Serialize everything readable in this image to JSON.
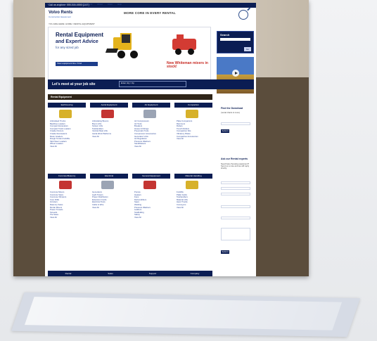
{
  "topbar": {
    "left_text": "Call us anytime: 000-000-0000 (24/7)",
    "links": [
      "Home",
      "Locations",
      "Rental Equipment",
      "About Volvo",
      "Help"
    ]
  },
  "header": {
    "logo_title": "Volvo Rents",
    "logo_subtitle": "Construction Equipment",
    "center_title": "MORE CORE IN EVERY RENTAL",
    "breadcrumb": "YOU ARE HERE: HOME / RENTAL EQUIPMENT"
  },
  "hero": {
    "line1": "Rental Equipment",
    "line2": "and Expert Advice",
    "line3": "for any sized job",
    "button": "View equipment line / Find",
    "right_text": "New Whiteman\nmixers in stock!"
  },
  "banner": {
    "title": "Let's meet at your job site",
    "box_text": "Enter city / zip"
  },
  "right_search": {
    "title": "Search",
    "button": "Go"
  },
  "section": {
    "title": "Rental Equipment"
  },
  "categories_top": [
    "Earthmoving",
    "Aerial Equipment",
    "Air Equipment",
    "Compaction"
  ],
  "categories_mid": [
    "Concrete/Masonry",
    "Electrical",
    "General Equipment",
    "Material Handling"
  ],
  "categories_top_items": [
    [
      "Articulated Trucks",
      "Backhoe Loaders",
      "Compact Excavators",
      "Compact Track Loaders",
      "Crawler Dozers",
      "Crawler Excavators",
      "Motor Graders",
      "Rough Terrain Forklifts",
      "Skid Steer Loaders",
      "Wheel Loaders",
      "View All"
    ],
    [
      "Articulating Booms",
      "Boom Lifts",
      "Scissor Lifts",
      "Telehandlers",
      "Vertical Mast Lifts",
      "Aerial Work Platforms",
      "View All"
    ],
    [
      "Air Compressors",
      "Air Tools",
      "Breakers",
      "Hoses & Fittings",
      "Pneumatic Tools",
      "Compressor Accessories",
      "Generator Units",
      "Air Regulators",
      "Pressure Washers",
      "Sandblasters",
      "View All"
    ],
    [
      "Plate Compactors",
      "Rammers",
      "Rollers",
      "Trench Rollers",
      "Compaction Kits",
      "Vibratory Plates",
      "Compaction Accessories",
      "View All"
    ]
  ],
  "categories_mid_items": [
    [
      "Concrete Mixers",
      "Concrete Saws",
      "Concrete Vibrators",
      "Core Drills",
      "Grinders",
      "Masonry Saws",
      "Mortar Mixers",
      "Power Trowels",
      "Screeds",
      "Tile Saws",
      "View All"
    ],
    [
      "Generators",
      "Light Towers",
      "Power Distribution",
      "Extension Cords",
      "Electrical Tools",
      "Cable & Wire",
      "View All"
    ],
    [
      "Pumps",
      "Heaters",
      "Fans",
      "Dehumidifiers",
      "Saws",
      "Welding",
      "Pressure Washers",
      "Ladders",
      "Scaffolding",
      "Safety",
      "View All"
    ],
    [
      "Forklifts",
      "Pallet Jacks",
      "Telehandlers",
      "Material Lifts",
      "Hand Trucks",
      "Conveyors",
      "View All"
    ]
  ],
  "right_panel": {
    "download_title": "Find the Download",
    "download_subtitle": "(rental charts & more)",
    "download_button": "Submit",
    "ask_title": "Ask our Rental experts",
    "ask_text": "Need help choosing equipment? Send us a note and we will reply shortly.",
    "ask_button": "Submit"
  },
  "footer_cols": [
    "Rental",
    "Sales",
    "Support",
    "Company"
  ],
  "colors": {
    "navy": "#0b1d53",
    "dark_brown": "#5b4d3c",
    "accent_red": "#c72b24"
  }
}
